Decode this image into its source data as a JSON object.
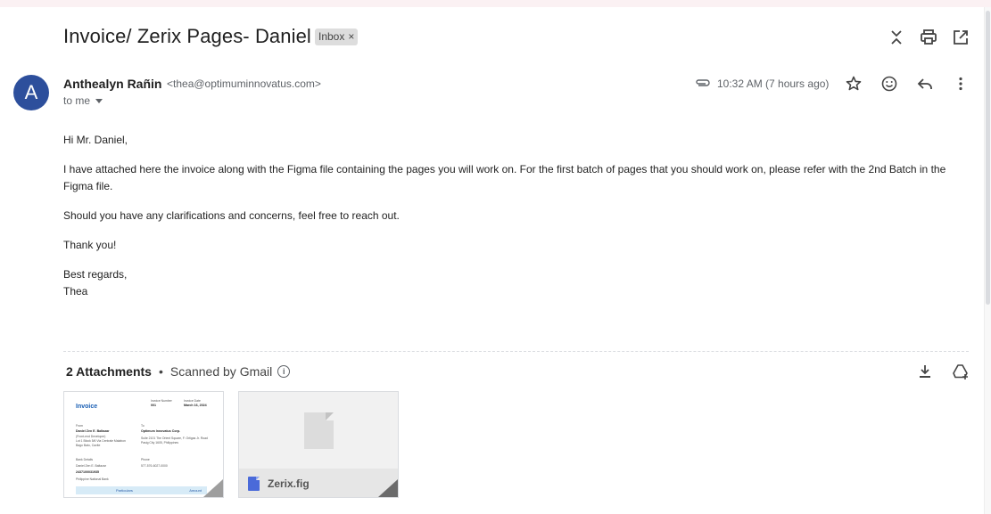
{
  "email": {
    "subject": "Invoice/ Zerix Pages- Daniel",
    "label": "Inbox",
    "label_close": "×",
    "sender": {
      "avatar_letter": "A",
      "name": "Anthealyn Rañin",
      "email": "<thea@optimuminnovatus.com>",
      "to": "to me"
    },
    "timestamp": "10:32 AM (7 hours ago)",
    "body": {
      "greeting": "Hi Mr. Daniel,",
      "para1": "I have attached here the invoice along with the Figma file containing the pages you will work on. For the first batch of pages that you should work on, please refer with the 2nd Batch in the Figma file.",
      "para2": "Should you have any clarifications and concerns, feel free to reach out.",
      "para3": "Thank you!",
      "closing": "Best regards,",
      "signature": "Thea"
    },
    "attachments": {
      "count_label": "2 Attachments",
      "dot": "•",
      "scanned_label": "Scanned by Gmail",
      "info_glyph": "i",
      "files": [
        {
          "preview_title": "Invoice",
          "invoice_number_label": "Invoice Number",
          "invoice_number": "001",
          "invoice_date_label": "Invoice Date",
          "invoice_date": "March 16, 2024",
          "from_label": "From",
          "from_name": "Daniel Zen E. Baltazar",
          "from_role": "(Front-end Developer)",
          "from_addr1": "Lot 1 Block 5/6 Via Centrale Malabon",
          "from_addr2": "Bago Bato, Cavite",
          "to_label": "To",
          "to_company": "Optimum Innovatus Corp.",
          "to_addr1": "Suite 2101 The Orient Square, F. Ortigas Jr. Road",
          "to_addr2": "Pasig City 1605, Philippines",
          "bank_label": "Bank Details",
          "bank_name": "Daniel Zen E. Baltazar",
          "bank_account": "2437100031935",
          "bank_bank": "Philippine National Bank",
          "phone_label": "Phone",
          "phone": "577-576-6027-0000",
          "col_particulars": "Particulars",
          "col_amount": "Amount"
        },
        {
          "file_name": "Zerix.fig"
        }
      ]
    }
  },
  "icons": {
    "collapse": "collapse-all-icon",
    "print": "print-icon",
    "popout": "open-in-new-window-icon",
    "attachment": "paperclip-icon",
    "star": "star-icon",
    "emoji": "emoji-reaction-icon",
    "reply": "reply-icon",
    "more": "more-vert-icon",
    "download": "download-all-icon",
    "drive": "add-to-drive-icon"
  },
  "colors": {
    "avatar_bg": "#2d4f9c",
    "figma_icon": "#4a6ad9"
  }
}
